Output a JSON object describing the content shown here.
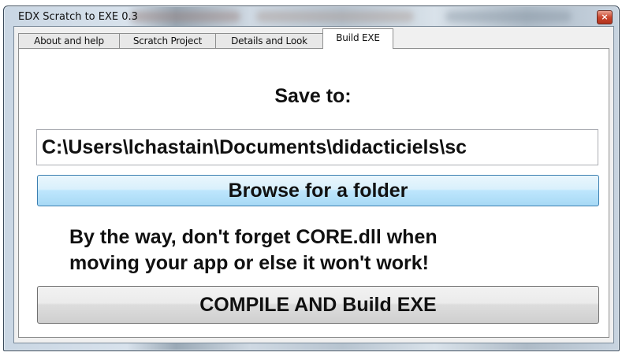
{
  "window": {
    "title": "EDX Scratch to EXE 0.3",
    "close_glyph": "×"
  },
  "tabs": [
    {
      "label": "About and help",
      "active": false
    },
    {
      "label": "Scratch Project",
      "active": false
    },
    {
      "label": "Details and Look",
      "active": false
    },
    {
      "label": "Build EXE",
      "active": true
    }
  ],
  "build": {
    "save_label": "Save to:",
    "path_value": "C:\\Users\\lchastain\\Documents\\didacticiels\\sc",
    "browse_label": "Browse for a folder",
    "note_line1": "By the way, don't forget CORE.dll when",
    "note_line2": "moving your app or else it won't work!",
    "compile_label": "COMPILE AND Build EXE"
  }
}
